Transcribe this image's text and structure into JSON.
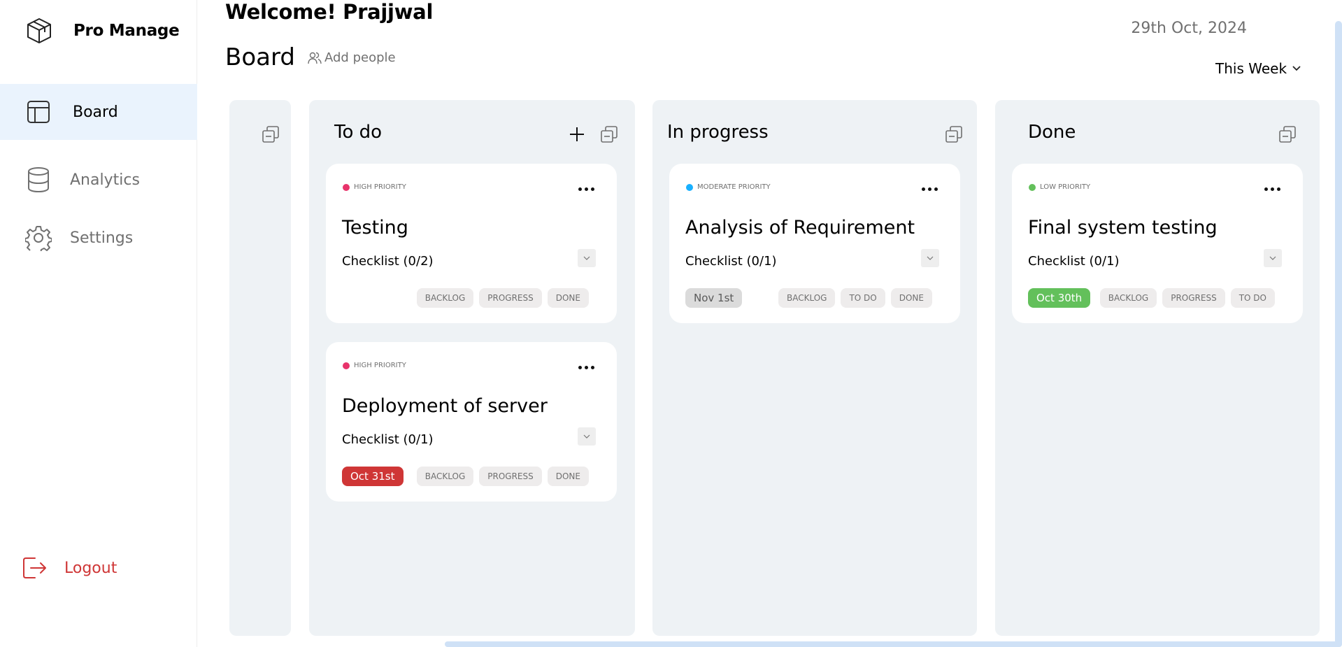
{
  "app": {
    "name": "Pro Manage"
  },
  "sidebar": {
    "items": [
      {
        "label": "Board",
        "icon": "layout-icon",
        "active": true
      },
      {
        "label": "Analytics",
        "icon": "database-icon",
        "active": false
      },
      {
        "label": "Settings",
        "icon": "gear-icon",
        "active": false
      }
    ],
    "logout_label": "Logout"
  },
  "header": {
    "welcome": "Welcome!  Prajjwal",
    "date": "29th Oct, 2024",
    "board_title": "Board",
    "add_people": "Add people",
    "filter": "This Week"
  },
  "columns": {
    "todo": {
      "title": "To do",
      "cards": [
        {
          "priority": "HIGH PRIORITY",
          "priority_color": "#e8336b",
          "title": "Testing",
          "checklist": "Checklist (0/2)",
          "due": "",
          "chips": [
            "BACKLOG",
            "PROGRESS",
            "DONE"
          ]
        },
        {
          "priority": "HIGH PRIORITY",
          "priority_color": "#e8336b",
          "title": "Deployment of server",
          "checklist": "Checklist (0/1)",
          "due": "Oct 31st",
          "chips": [
            "BACKLOG",
            "PROGRESS",
            "DONE"
          ]
        }
      ]
    },
    "progress": {
      "title": "In progress",
      "cards": [
        {
          "priority": "MODERATE PRIORITY",
          "priority_color": "#18b0ff",
          "title": "Analysis of Requirement",
          "checklist": "Checklist (0/1)",
          "due": "Nov 1st",
          "chips": [
            "BACKLOG",
            "TO DO",
            "DONE"
          ]
        }
      ]
    },
    "done": {
      "title": "Done",
      "cards": [
        {
          "priority": "LOW PRIORITY",
          "priority_color": "#63c05b",
          "title": "Final system testing",
          "checklist": "Checklist (0/1)",
          "due": "Oct 30th",
          "chips": [
            "BACKLOG",
            "PROGRESS",
            "TO DO"
          ]
        }
      ]
    }
  },
  "colors": {
    "accent_bg": "#eaf3fd",
    "danger": "#cf3636",
    "success": "#63c05b",
    "column_bg": "#eef2f5"
  }
}
